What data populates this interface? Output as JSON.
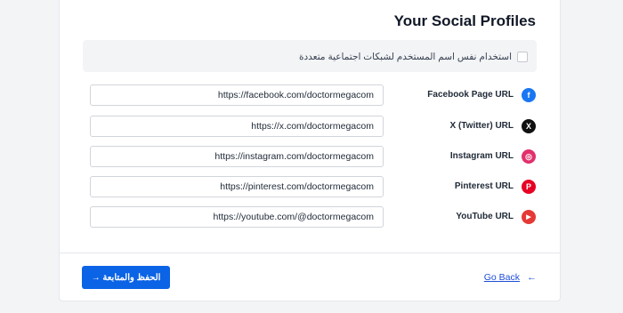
{
  "page": {
    "title": "Your Social Profiles"
  },
  "same_username": {
    "label": "استخدام نفس اسم المستخدم لشبكات اجتماعية متعددة",
    "checked": false
  },
  "profiles": [
    {
      "label": "Facebook Page URL",
      "value": "https://facebook.com/doctormegacom",
      "icon": "facebook-icon",
      "icon_glyph": "f",
      "color": "#1877f2"
    },
    {
      "label": "X (Twitter) URL",
      "value": "https://x.com/doctormegacom",
      "icon": "x-twitter-icon",
      "icon_glyph": "X",
      "color": "#111111"
    },
    {
      "label": "Instagram URL",
      "value": "https://instagram.com/doctormegacom",
      "icon": "instagram-icon",
      "icon_glyph": "◎",
      "color": "#e1306c"
    },
    {
      "label": "Pinterest URL",
      "value": "https://pinterest.com/doctormegacom",
      "icon": "pinterest-icon",
      "icon_glyph": "P",
      "color": "#e60023"
    },
    {
      "label": "YouTube URL",
      "value": "https://youtube.com/@doctormegacom",
      "icon": "youtube-icon",
      "icon_glyph": "▶",
      "color": "#e53935"
    }
  ],
  "footer": {
    "save_label": "الحفظ والمتابعة →",
    "back_label": "Go Back",
    "back_arrow": "←",
    "primary_color": "#0b63e5"
  }
}
